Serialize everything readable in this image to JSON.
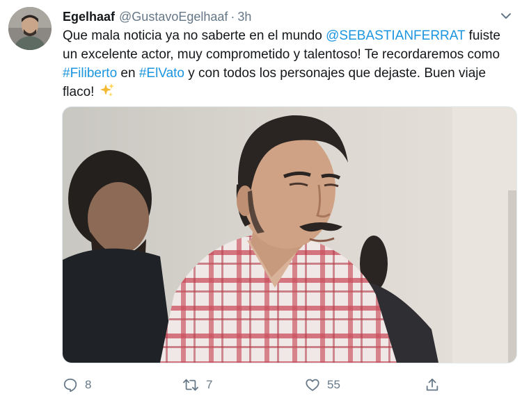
{
  "tweet": {
    "author_name": "Egelhaaf",
    "handle": "@GustavoEgelhaaf",
    "separator": "·",
    "time": "3h",
    "text": {
      "part1": "Que mala noticia ya no saberte en el mundo ",
      "mention": "@SEBASTIANFERRAT",
      "part2": " fuiste un excelente actor, muy comprometido y talentoso! Te recordaremos como ",
      "hashtag1": "#Filiberto",
      "part3": " en ",
      "hashtag2": "#ElVato",
      "part4": " y con todos los personajes que dejaste. Buen viaje flaco! "
    },
    "emoji": "sparkles-emoji",
    "actions": {
      "replies": "8",
      "retweets": "7",
      "likes": "55"
    },
    "colors": {
      "link": "#1b95e0",
      "secondary_text": "#657786"
    },
    "icons": [
      "avatar",
      "chevron-down-icon",
      "reply-icon",
      "retweet-icon",
      "like-icon",
      "share-icon"
    ]
  }
}
